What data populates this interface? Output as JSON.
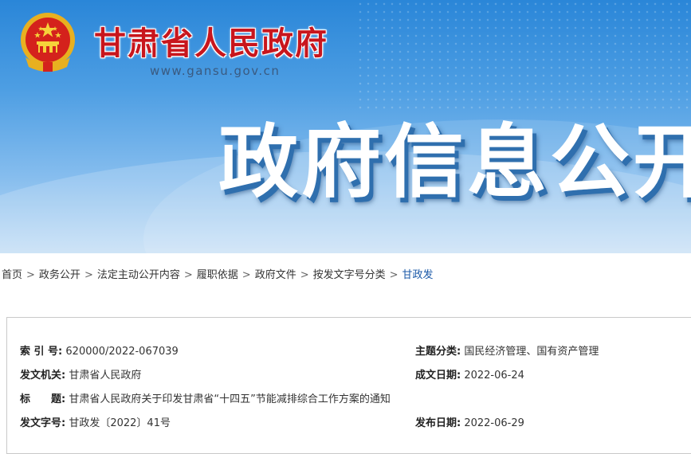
{
  "header": {
    "site_title": "甘肃省人民政府",
    "site_url": "www.gansu.gov.cn",
    "banner_title": "政府信息公开",
    "colors": {
      "title_red": "#c8161d",
      "banner_blue": "#2a86d8",
      "link_blue": "#1c5aa8"
    }
  },
  "breadcrumb": {
    "items": [
      "首页",
      "政务公开",
      "法定主动公开内容",
      "履职依据",
      "政府文件",
      "按发文字号分类"
    ],
    "current": "甘政发",
    "separator": ">"
  },
  "info": {
    "index_label": "索 引 号:",
    "index_value": "620000/2022-067039",
    "topic_label": "主题分类:",
    "topic_value": "国民经济管理、国有资产管理",
    "issuer_label": "发文机关:",
    "issuer_value": "甘肃省人民政府",
    "created_label": "成文日期:",
    "created_value": "2022-06-24",
    "title_label": "标　　题:",
    "title_value": "甘肃省人民政府关于印发甘肃省“十四五”节能减排综合工作方案的通知",
    "docno_label": "发文字号:",
    "docno_value": "甘政发〔2022〕41号",
    "published_label": "发布日期:",
    "published_value": "2022-06-29"
  }
}
